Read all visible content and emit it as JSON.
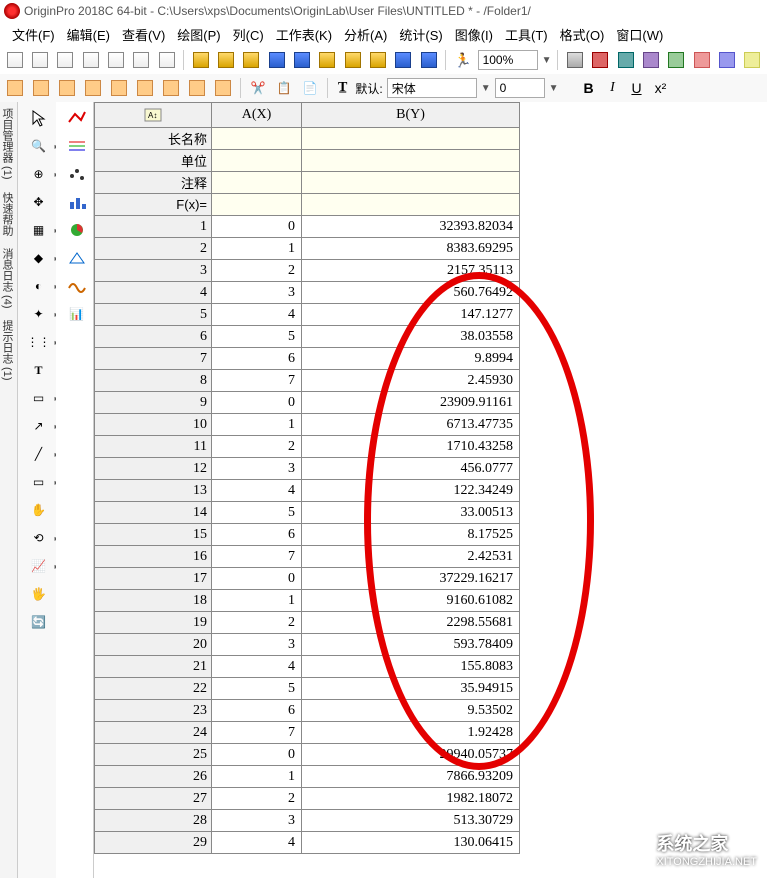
{
  "title": "OriginPro 2018C 64-bit - C:\\Users\\xps\\Documents\\OriginLab\\User Files\\UNTITLED * - /Folder1/",
  "menu": [
    "文件(F)",
    "编辑(E)",
    "查看(V)",
    "绘图(P)",
    "列(C)",
    "工作表(K)",
    "分析(A)",
    "统计(S)",
    "图像(I)",
    "工具(T)",
    "格式(O)",
    "窗口(W)"
  ],
  "zoom": "100%",
  "font_prefix": "默认: ",
  "font_name": "宋体",
  "font_size": "0",
  "side_tabs": [
    "项目管理器 (1)",
    "快速帮助",
    "消息日志 (4)",
    "提示日志 (1)"
  ],
  "columns": {
    "a": "A(X)",
    "b": "B(Y)"
  },
  "meta_labels": [
    "长名称",
    "单位",
    "注释",
    "F(x)="
  ],
  "rows": [
    {
      "n": 1,
      "a": "0",
      "b": "32393.82034"
    },
    {
      "n": 2,
      "a": "1",
      "b": "8383.69295"
    },
    {
      "n": 3,
      "a": "2",
      "b": "2157.35113"
    },
    {
      "n": 4,
      "a": "3",
      "b": "560.76492"
    },
    {
      "n": 5,
      "a": "4",
      "b": "147.1277"
    },
    {
      "n": 6,
      "a": "5",
      "b": "38.03558"
    },
    {
      "n": 7,
      "a": "6",
      "b": "9.8994"
    },
    {
      "n": 8,
      "a": "7",
      "b": "2.45930"
    },
    {
      "n": 9,
      "a": "0",
      "b": "23909.91161"
    },
    {
      "n": 10,
      "a": "1",
      "b": "6713.47735"
    },
    {
      "n": 11,
      "a": "2",
      "b": "1710.43258"
    },
    {
      "n": 12,
      "a": "3",
      "b": "456.0777"
    },
    {
      "n": 13,
      "a": "4",
      "b": "122.34249"
    },
    {
      "n": 14,
      "a": "5",
      "b": "33.00513"
    },
    {
      "n": 15,
      "a": "6",
      "b": "8.17525"
    },
    {
      "n": 16,
      "a": "7",
      "b": "2.42531"
    },
    {
      "n": 17,
      "a": "0",
      "b": "37229.16217"
    },
    {
      "n": 18,
      "a": "1",
      "b": "9160.61082"
    },
    {
      "n": 19,
      "a": "2",
      "b": "2298.55681"
    },
    {
      "n": 20,
      "a": "3",
      "b": "593.78409"
    },
    {
      "n": 21,
      "a": "4",
      "b": "155.8083"
    },
    {
      "n": 22,
      "a": "5",
      "b": "35.94915"
    },
    {
      "n": 23,
      "a": "6",
      "b": "9.53502"
    },
    {
      "n": 24,
      "a": "7",
      "b": "1.92428"
    },
    {
      "n": 25,
      "a": "0",
      "b": "29940.05737"
    },
    {
      "n": 26,
      "a": "1",
      "b": "7866.93209"
    },
    {
      "n": 27,
      "a": "2",
      "b": "1982.18072"
    },
    {
      "n": 28,
      "a": "3",
      "b": "513.30729"
    },
    {
      "n": 29,
      "a": "4",
      "b": "130.06415"
    }
  ],
  "watermark": {
    "line1": "系统之家",
    "line2": "XITONGZHIJIA.NET"
  }
}
